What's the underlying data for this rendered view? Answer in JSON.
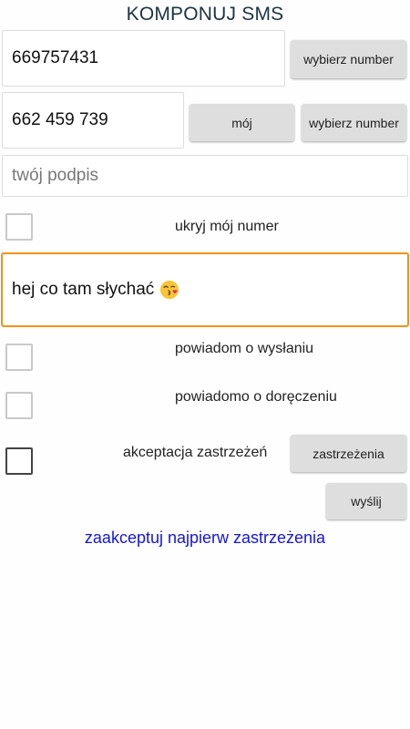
{
  "header": {
    "title": "KOMPONUJ SMS"
  },
  "recipient": {
    "number": "669757431",
    "choose_button": "wybierz number"
  },
  "sender": {
    "number": "662 459 739",
    "mine_button": "mój",
    "choose_button": "wybierz number"
  },
  "signature": {
    "placeholder": "twój podpis"
  },
  "options": {
    "hide_number": "ukryj mój numer",
    "notify_sent": "powiadom o wysłaniu",
    "notify_delivered": "powiadomo o doręczeniu",
    "accept_terms": "akceptacja zastrzeżeń",
    "terms_button": "zastrzeżenia"
  },
  "message": {
    "text": "hej co tam słychać",
    "emoji": "kiss-wink-emoji"
  },
  "send_button": "wyślij",
  "warning": {
    "text": "zaakceptuj najpierw zastrzeżenia",
    "color": "#1515e0"
  },
  "colors": {
    "accent_focus": "#f29218",
    "title": "#1c3342"
  }
}
